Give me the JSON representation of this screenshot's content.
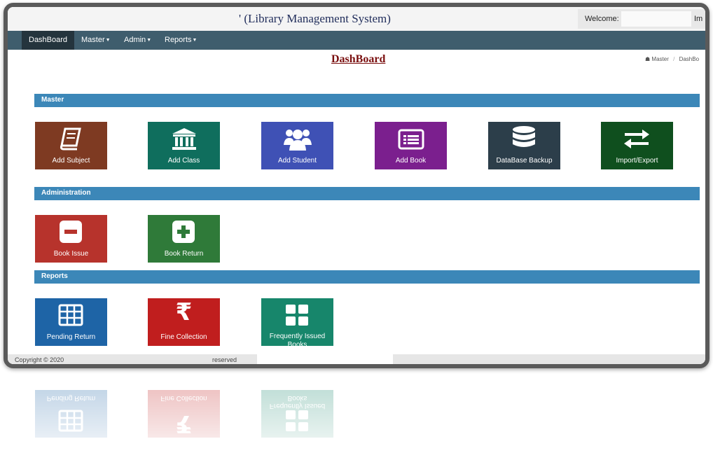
{
  "header": {
    "app_title": "' (Library Management System)",
    "welcome_label": "Welcome:",
    "welcome_cut": "Im"
  },
  "nav": {
    "items": [
      {
        "label": "DashBoard",
        "active": true
      },
      {
        "label": "Master",
        "dropdown": true
      },
      {
        "label": "Admin",
        "dropdown": true
      },
      {
        "label": "Reports",
        "dropdown": true
      }
    ]
  },
  "page": {
    "title": "DashBoard",
    "breadcrumb": [
      "Master",
      "DashBo"
    ]
  },
  "sections": [
    {
      "label": "Master",
      "tiles": [
        {
          "label": "Add Subject",
          "icon": "book-icon",
          "color": "#7e3a22"
        },
        {
          "label": "Add Class",
          "icon": "institution-icon",
          "color": "#0f6e5d"
        },
        {
          "label": "Add Student",
          "icon": "users-icon",
          "color": "#3f51b5"
        },
        {
          "label": "Add Book",
          "icon": "list-card-icon",
          "color": "#7b1f8e"
        },
        {
          "label": "DataBase Backup",
          "icon": "database-icon",
          "color": "#2c3e4a"
        },
        {
          "label": "Import/Export",
          "icon": "exchange-icon",
          "color": "#0f4f1e"
        }
      ]
    },
    {
      "label": "Administration",
      "tiles": [
        {
          "label": "Book Issue",
          "icon": "minus-square-icon",
          "color": "#b7332c"
        },
        {
          "label": "Book Return",
          "icon": "plus-square-icon",
          "color": "#2f7a39"
        }
      ]
    },
    {
      "label": "Reports",
      "tiles": [
        {
          "label": "Pending Return",
          "icon": "table-icon",
          "color": "#1e64a6"
        },
        {
          "label": "Fine Collection",
          "icon": "rupee-icon",
          "color": "#c01e1e"
        },
        {
          "label": "Frequently Issued Books",
          "icon": "grid-icon",
          "color": "#17866b"
        }
      ]
    }
  ],
  "footer": {
    "copyright": "Copyright © 2020",
    "reserved": "reserved"
  }
}
